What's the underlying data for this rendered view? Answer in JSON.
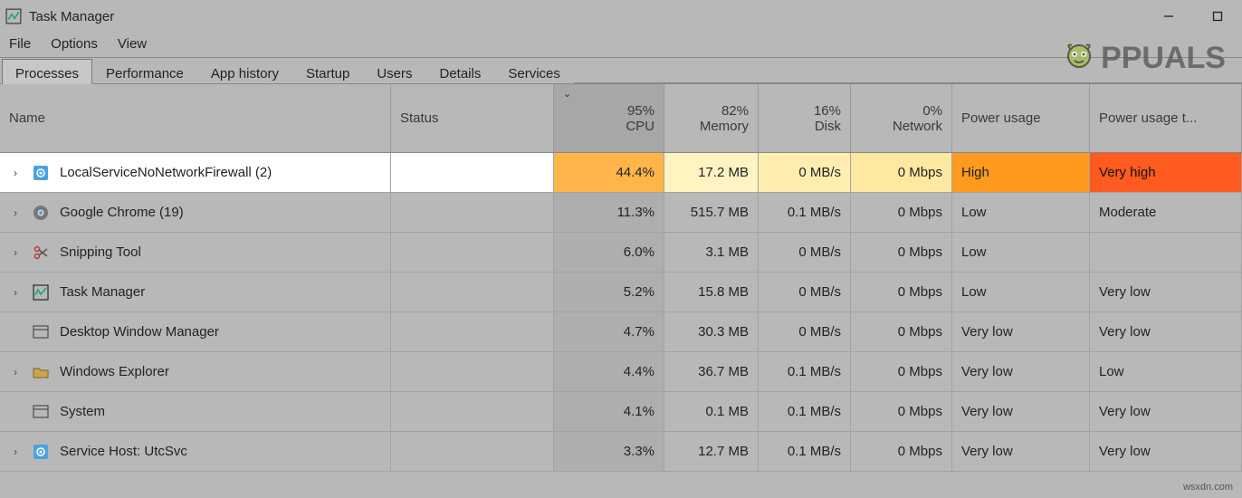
{
  "window": {
    "title": "Task Manager"
  },
  "menu": {
    "file": "File",
    "options": "Options",
    "view": "View"
  },
  "tabs": {
    "processes": "Processes",
    "performance": "Performance",
    "app_history": "App history",
    "startup": "Startup",
    "users": "Users",
    "details": "Details",
    "services": "Services"
  },
  "columns": {
    "name": "Name",
    "status": "Status",
    "cpu_pct": "95%",
    "cpu_label": "CPU",
    "mem_pct": "82%",
    "mem_label": "Memory",
    "disk_pct": "16%",
    "disk_label": "Disk",
    "net_pct": "0%",
    "net_label": "Network",
    "power_usage": "Power usage",
    "power_usage_trend": "Power usage t..."
  },
  "rows": [
    {
      "icon": "gear-icon",
      "expandable": true,
      "name": "LocalServiceNoNetworkFirewall (2)",
      "cpu": "44.4%",
      "memory": "17.2 MB",
      "disk": "0 MB/s",
      "network": "0 Mbps",
      "power_usage": "High",
      "power_usage_trend": "Very high",
      "highlight": true
    },
    {
      "icon": "chrome-icon",
      "expandable": true,
      "name": "Google Chrome (19)",
      "cpu": "11.3%",
      "memory": "515.7 MB",
      "disk": "0.1 MB/s",
      "network": "0 Mbps",
      "power_usage": "Low",
      "power_usage_trend": "Moderate"
    },
    {
      "icon": "scissors-icon",
      "expandable": true,
      "name": "Snipping Tool",
      "cpu": "6.0%",
      "memory": "3.1 MB",
      "disk": "0 MB/s",
      "network": "0 Mbps",
      "power_usage": "Low",
      "power_usage_trend": ""
    },
    {
      "icon": "taskmanager-icon",
      "expandable": true,
      "name": "Task Manager",
      "cpu": "5.2%",
      "memory": "15.8 MB",
      "disk": "0 MB/s",
      "network": "0 Mbps",
      "power_usage": "Low",
      "power_usage_trend": "Very low"
    },
    {
      "icon": "window-icon",
      "expandable": false,
      "name": "Desktop Window Manager",
      "cpu": "4.7%",
      "memory": "30.3 MB",
      "disk": "0 MB/s",
      "network": "0 Mbps",
      "power_usage": "Very low",
      "power_usage_trend": "Very low"
    },
    {
      "icon": "folder-icon",
      "expandable": true,
      "name": "Windows Explorer",
      "cpu": "4.4%",
      "memory": "36.7 MB",
      "disk": "0.1 MB/s",
      "network": "0 Mbps",
      "power_usage": "Very low",
      "power_usage_trend": "Low"
    },
    {
      "icon": "window-icon",
      "expandable": false,
      "name": "System",
      "cpu": "4.1%",
      "memory": "0.1 MB",
      "disk": "0.1 MB/s",
      "network": "0 Mbps",
      "power_usage": "Very low",
      "power_usage_trend": "Very low"
    },
    {
      "icon": "gear-icon",
      "expandable": true,
      "name": "Service Host: UtcSvc",
      "cpu": "3.3%",
      "memory": "12.7 MB",
      "disk": "0.1 MB/s",
      "network": "0 Mbps",
      "power_usage": "Very low",
      "power_usage_trend": "Very low"
    }
  ],
  "watermark": "PPUALS",
  "footnote": "wsxdn.com"
}
